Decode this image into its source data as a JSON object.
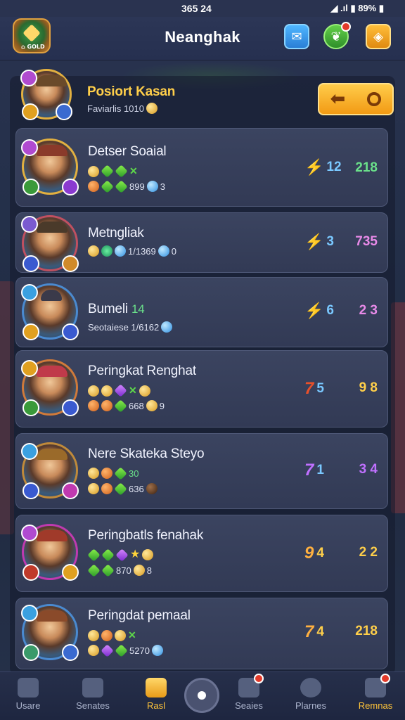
{
  "status_bar": {
    "time": "365 24",
    "right": "◢ .ıl ▮ 89% ▮"
  },
  "header": {
    "title": "Neanghak",
    "logo_text": "⌂ GOLD"
  },
  "top_icons": [
    "mail-icon",
    "leaf-icon",
    "ticket-icon"
  ],
  "featured": {
    "name": "Posiort Kasan",
    "sub": "Faviarlis 1010",
    "button_left": "⬅",
    "button_right": "○"
  },
  "rows": [
    {
      "name": "Detser Soaial",
      "sub_line2": "899",
      "sub_line2_b": "3",
      "stat1": "12",
      "stat2": "218"
    },
    {
      "name": "Metngliak",
      "sub_line1": "1/1369",
      "sub_line1_b": "0",
      "stat1": "3",
      "stat2": "735"
    },
    {
      "name": "Bumeli",
      "name_suffix": "14",
      "sub_line1": "Seotaiese 1/6162",
      "stat1": "6",
      "stat2": "2 3"
    },
    {
      "name": "Peringkat Renghat",
      "sub_line2": "668",
      "sub_line2_b": "9",
      "stat1": "5",
      "stat1_prefix": "7",
      "stat2": "9 8"
    },
    {
      "name": "Nere Skateka Steyo",
      "sub_line1": "30",
      "sub_line2": "636",
      "stat1": "1",
      "stat1_prefix": "7",
      "stat2": "3 4"
    },
    {
      "name": "Peringbatls fenahak",
      "sub_line2": "870",
      "sub_line2_b": "8",
      "stat1": "4",
      "stat1_prefix": "9",
      "stat2": "2 2"
    },
    {
      "name": "Peringdat pemaal",
      "sub_line2": "5270",
      "stat1": "4",
      "stat1_prefix": "7",
      "stat2": "218"
    }
  ],
  "nav": {
    "items": [
      {
        "label": "Usare",
        "active": false
      },
      {
        "label": "Senates",
        "active": false
      },
      {
        "label": "Rasl",
        "active": true
      },
      {
        "label": "Seaies",
        "active": false
      },
      {
        "label": "Plarnes",
        "active": false
      },
      {
        "label": "Remnas",
        "active": false
      }
    ]
  },
  "colors": {
    "accent": "#ffc43a",
    "panel": "#323a55",
    "bg": "#24304a"
  }
}
